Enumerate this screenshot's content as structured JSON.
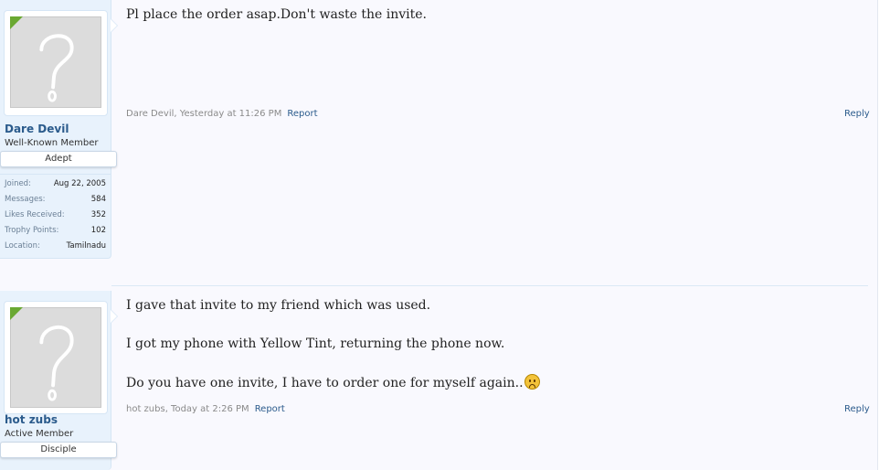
{
  "posts": [
    {
      "username": "Dare Devil",
      "user_title": "Well-Known Member",
      "banner": "Adept",
      "stats": [
        {
          "label": "Joined:",
          "value": "Aug 22, 2005"
        },
        {
          "label": "Messages:",
          "value": "584"
        },
        {
          "label": "Likes Received:",
          "value": "352"
        },
        {
          "label": "Trophy Points:",
          "value": "102"
        },
        {
          "label": "Location:",
          "value": "Tamilnadu"
        }
      ],
      "message": [
        "Pl place the order asap.Don't waste the invite."
      ],
      "meta_author_time": "Dare Devil, Yesterday at 11:26 PM",
      "report_label": "Report",
      "reply_label": "Reply"
    },
    {
      "username": "hot zubs",
      "user_title": "Active Member",
      "banner": "Disciple",
      "message": [
        "I gave that invite to my friend which was used.",
        "I got my phone with Yellow Tint, returning the phone now.",
        "Do you have one invite, I have to order one for myself again.."
      ],
      "emoji_icon": "sad-face-icon",
      "meta_author_time": "hot zubs, Today at 2:26 PM",
      "report_label": "Report",
      "reply_label": "Reply"
    }
  ]
}
